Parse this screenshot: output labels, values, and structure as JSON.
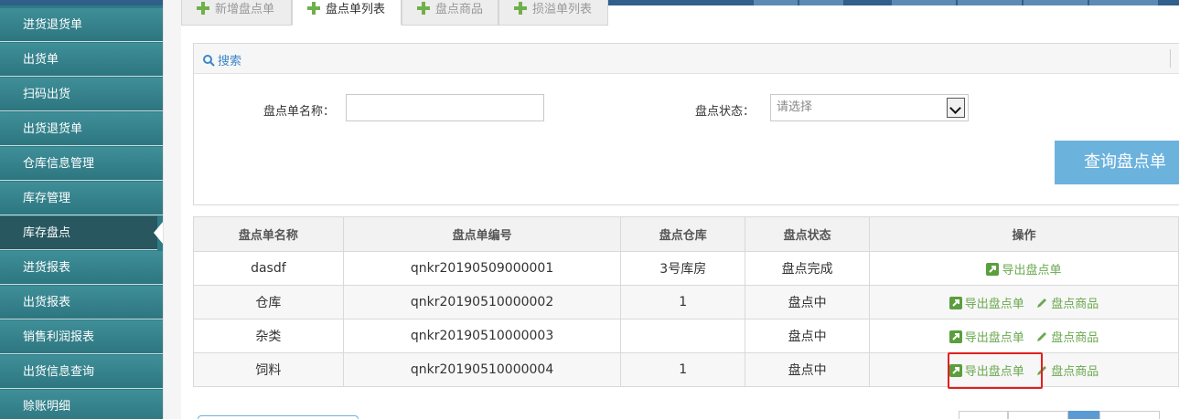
{
  "sidebar": {
    "items": [
      {
        "label": "进货退货单",
        "active": false
      },
      {
        "label": "出货单",
        "active": false
      },
      {
        "label": "扫码出货",
        "active": false
      },
      {
        "label": "出货退货单",
        "active": false
      },
      {
        "label": "仓库信息管理",
        "active": false
      },
      {
        "label": "库存管理",
        "active": false
      },
      {
        "label": "库存盘点",
        "active": true
      },
      {
        "label": "进货报表",
        "active": false
      },
      {
        "label": "出货报表",
        "active": false
      },
      {
        "label": "销售利润报表",
        "active": false
      },
      {
        "label": "出货信息查询",
        "active": false
      },
      {
        "label": "赊账明细",
        "active": false
      }
    ]
  },
  "tabs": [
    {
      "label": "新增盘点单",
      "active": false
    },
    {
      "label": "盘点单列表",
      "active": true
    },
    {
      "label": "盘点商品",
      "active": false
    },
    {
      "label": "损溢单列表",
      "active": false
    }
  ],
  "search": {
    "header_label": "搜索",
    "name_label": "盘点单名称：",
    "name_value": "",
    "status_label": "盘点状态：",
    "status_placeholder": "请选择",
    "query_button": "查询盘点单"
  },
  "table": {
    "headers": [
      "盘点单名称",
      "盘点单编号",
      "盘点仓库",
      "盘点状态",
      "操作"
    ],
    "rows": [
      {
        "name": "dasdf",
        "code": "qnkr20190509000001",
        "warehouse": "3号库房",
        "status": "盘点完成"
      },
      {
        "name": "仓库",
        "code": "qnkr20190510000002",
        "warehouse": "1",
        "status": "盘点中"
      },
      {
        "name": "杂类",
        "code": "qnkr20190510000003",
        "warehouse": "",
        "status": "盘点中"
      },
      {
        "name": "饲料",
        "code": "qnkr20190510000004",
        "warehouse": "1",
        "status": "盘点中"
      }
    ],
    "action_export": "导出盘点单",
    "action_goods": "盘点商品"
  },
  "colors": {
    "sidebar": "#2f7b85",
    "sidebar_active": "#28575f",
    "accent_green": "#6aa84f",
    "accent_blue": "#6bb2dd",
    "highlight_red": "#e02020"
  }
}
